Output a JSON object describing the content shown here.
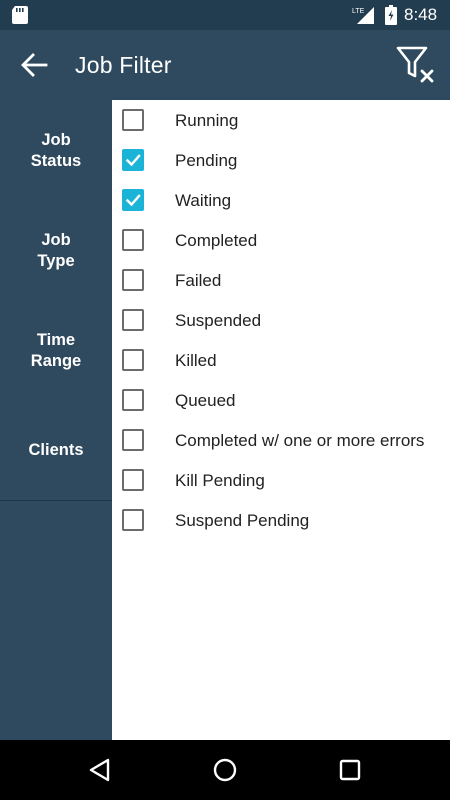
{
  "status_bar": {
    "time": "8:48",
    "network_label": "LTE",
    "icons": [
      "sd-card-icon",
      "signal-icon",
      "battery-icon"
    ]
  },
  "app_bar": {
    "title": "Job Filter",
    "back_icon": "arrow-back-icon",
    "clear_filter_icon": "filter-clear-icon"
  },
  "side_nav": {
    "items": [
      {
        "label_line1": "Job",
        "label_line2": "Status"
      },
      {
        "label_line1": "Job",
        "label_line2": "Type"
      },
      {
        "label_line1": "Time",
        "label_line2": "Range"
      },
      {
        "label_line1": "Clients",
        "label_line2": ""
      }
    ]
  },
  "job_status_options": [
    {
      "label": "Running",
      "checked": false
    },
    {
      "label": "Pending",
      "checked": true
    },
    {
      "label": "Waiting",
      "checked": true
    },
    {
      "label": "Completed",
      "checked": false
    },
    {
      "label": "Failed",
      "checked": false
    },
    {
      "label": "Suspended",
      "checked": false
    },
    {
      "label": "Killed",
      "checked": false
    },
    {
      "label": "Queued",
      "checked": false
    },
    {
      "label": "Completed w/ one or more errors",
      "checked": false
    },
    {
      "label": "Kill Pending",
      "checked": false
    },
    {
      "label": "Suspend Pending",
      "checked": false
    }
  ],
  "colors": {
    "primary": "#2f4a5e",
    "status_bar": "#233d50",
    "accent_checkbox": "#1bb3d6"
  },
  "system_nav": {
    "icons": [
      "back-triangle-icon",
      "home-circle-icon",
      "recents-square-icon"
    ]
  }
}
